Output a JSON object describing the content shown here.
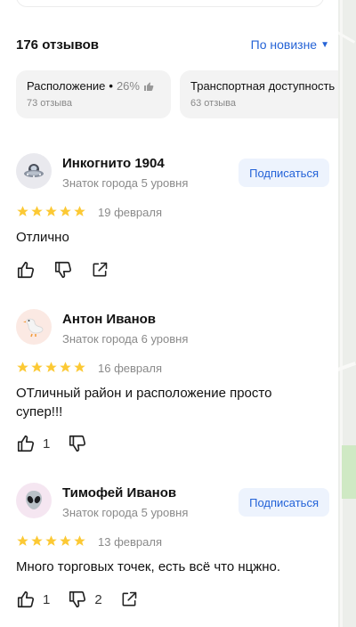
{
  "header": {
    "reviews_count": "176 отзывов",
    "sort_label": "По новизне",
    "sort_arrow": "▼"
  },
  "chips": [
    {
      "title": "Расположение",
      "separator": "•",
      "percent": "26%",
      "subtitle": "73 отзыва"
    },
    {
      "title": "Транспортная доступность",
      "subtitle": "63 отзыва"
    }
  ],
  "reviews": [
    {
      "author": "Инкогнито 1904",
      "level": "Знаток города 5 уровня",
      "follow_label": "Подписаться",
      "date": "19 февраля",
      "text": "Отлично",
      "avatar_icon": "ufo-icon",
      "likes": "",
      "dislikes": ""
    },
    {
      "author": "Антон Иванов",
      "level": "Знаток города 6 уровня",
      "date": "16 февраля",
      "text": "ОТличный район и расположение просто супер!!!",
      "avatar_icon": "goose-icon",
      "likes": "1",
      "dislikes": ""
    },
    {
      "author": "Тимофей Иванов",
      "level": "Знаток города 5 уровня",
      "follow_label": "Подписаться",
      "date": "13 февраля",
      "text": "Много торговых точек, есть всё что нцжно.",
      "avatar_icon": "alien-icon",
      "likes": "1",
      "dislikes": "2"
    }
  ],
  "colors": {
    "accent": "#2563d6",
    "star": "#fcc934",
    "follow_bg": "#edf3fd"
  }
}
